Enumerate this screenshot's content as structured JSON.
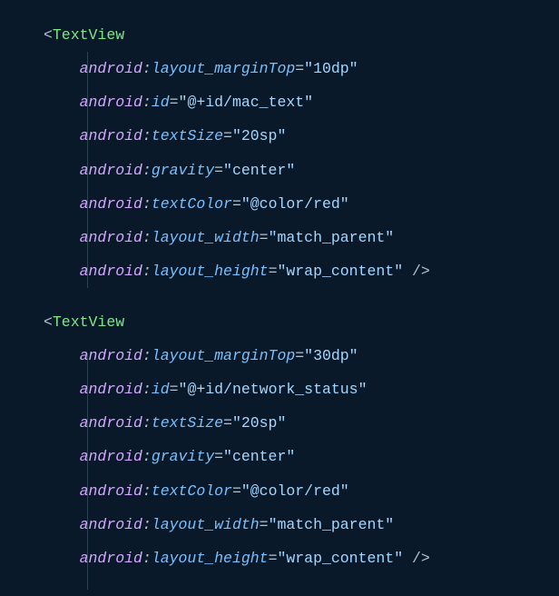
{
  "code": {
    "block1": {
      "tagOpen": "<",
      "tagName": "TextView",
      "attrs": [
        {
          "ns": "android",
          "colon": ":",
          "name": "layout_marginTop",
          "eq": "=",
          "val": "\"10dp\""
        },
        {
          "ns": "android",
          "colon": ":",
          "name": "id",
          "eq": "=",
          "val": "\"@+id/mac_text\""
        },
        {
          "ns": "android",
          "colon": ":",
          "name": "textSize",
          "eq": "=",
          "val": "\"20sp\""
        },
        {
          "ns": "android",
          "colon": ":",
          "name": "gravity",
          "eq": "=",
          "val": "\"center\""
        },
        {
          "ns": "android",
          "colon": ":",
          "name": "textColor",
          "eq": "=",
          "val": "\"@color/red\""
        },
        {
          "ns": "android",
          "colon": ":",
          "name": "layout_width",
          "eq": "=",
          "val": "\"match_parent\""
        },
        {
          "ns": "android",
          "colon": ":",
          "name": "layout_height",
          "eq": "=",
          "val": "\"wrap_content\""
        }
      ],
      "tagClose": " />"
    },
    "block2": {
      "tagOpen": "<",
      "tagName": "TextView",
      "attrs": [
        {
          "ns": "android",
          "colon": ":",
          "name": "layout_marginTop",
          "eq": "=",
          "val": "\"30dp\""
        },
        {
          "ns": "android",
          "colon": ":",
          "name": "id",
          "eq": "=",
          "val": "\"@+id/network_status\""
        },
        {
          "ns": "android",
          "colon": ":",
          "name": "textSize",
          "eq": "=",
          "val": "\"20sp\""
        },
        {
          "ns": "android",
          "colon": ":",
          "name": "gravity",
          "eq": "=",
          "val": "\"center\""
        },
        {
          "ns": "android",
          "colon": ":",
          "name": "textColor",
          "eq": "=",
          "val": "\"@color/red\""
        },
        {
          "ns": "android",
          "colon": ":",
          "name": "layout_width",
          "eq": "=",
          "val": "\"match_parent\""
        },
        {
          "ns": "android",
          "colon": ":",
          "name": "layout_height",
          "eq": "=",
          "val": "\"wrap_content\""
        }
      ],
      "tagClose": " />"
    }
  }
}
